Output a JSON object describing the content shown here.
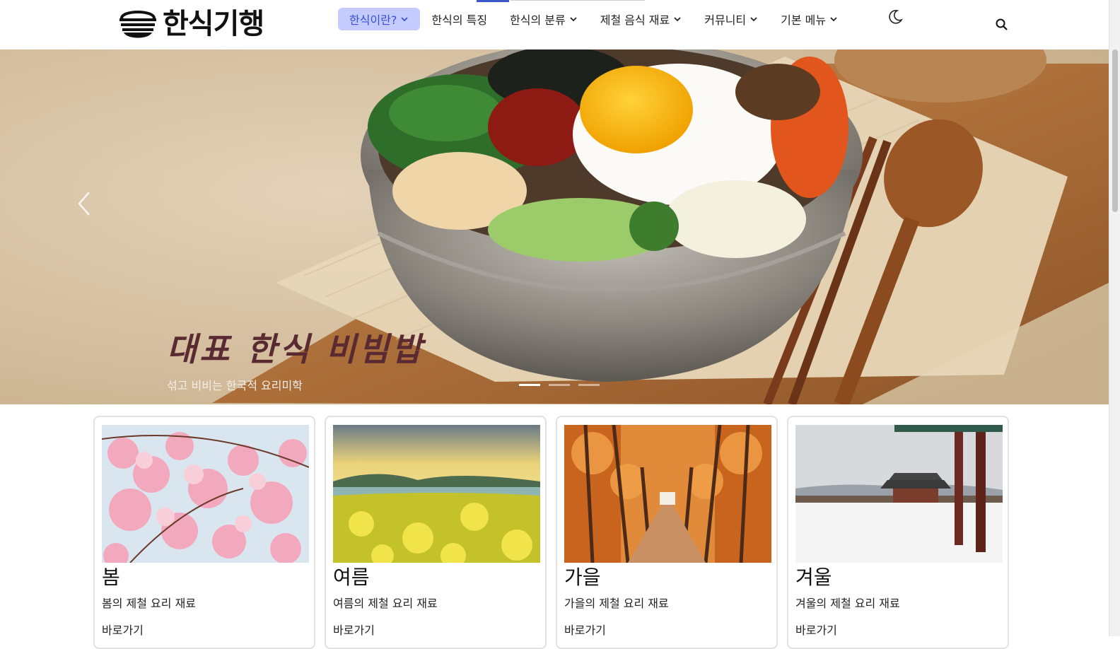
{
  "brand": {
    "name": "한식기행"
  },
  "nav": {
    "items": [
      {
        "label": "한식이란?",
        "dropdown": true,
        "active": true
      },
      {
        "label": "한식의 특징",
        "dropdown": false
      },
      {
        "label": "한식의 분류",
        "dropdown": true
      },
      {
        "label": "제철 음식 재료",
        "dropdown": true
      },
      {
        "label": "커뮤니티",
        "dropdown": true
      },
      {
        "label": "기본 메뉴",
        "dropdown": true
      }
    ],
    "theme_toggle_icon": "moon-icon",
    "search_icon": "search-icon"
  },
  "hero": {
    "title": "대표 한식 비빔밥",
    "subtitle": "섞고 비비는 한국적 요리미학",
    "slides": 3,
    "active_slide": 1
  },
  "seasons": [
    {
      "title": "봄",
      "desc": "봄의 제철 요리 재료",
      "link": "바로가기",
      "image": "cherry-blossoms"
    },
    {
      "title": "여름",
      "desc": "여름의 제철 요리 재료",
      "link": "바로가기",
      "image": "rapeseed-field"
    },
    {
      "title": "가을",
      "desc": "가을의 제철 요리 재료",
      "link": "바로가기",
      "image": "autumn-tree-path"
    },
    {
      "title": "겨울",
      "desc": "겨울의 제철 요리 재료",
      "link": "바로가기",
      "image": "snowy-palace"
    }
  ],
  "colors": {
    "accent": "#3b4ed6",
    "active_bg": "#c4cbff",
    "hero_title": "#5a2a33"
  }
}
